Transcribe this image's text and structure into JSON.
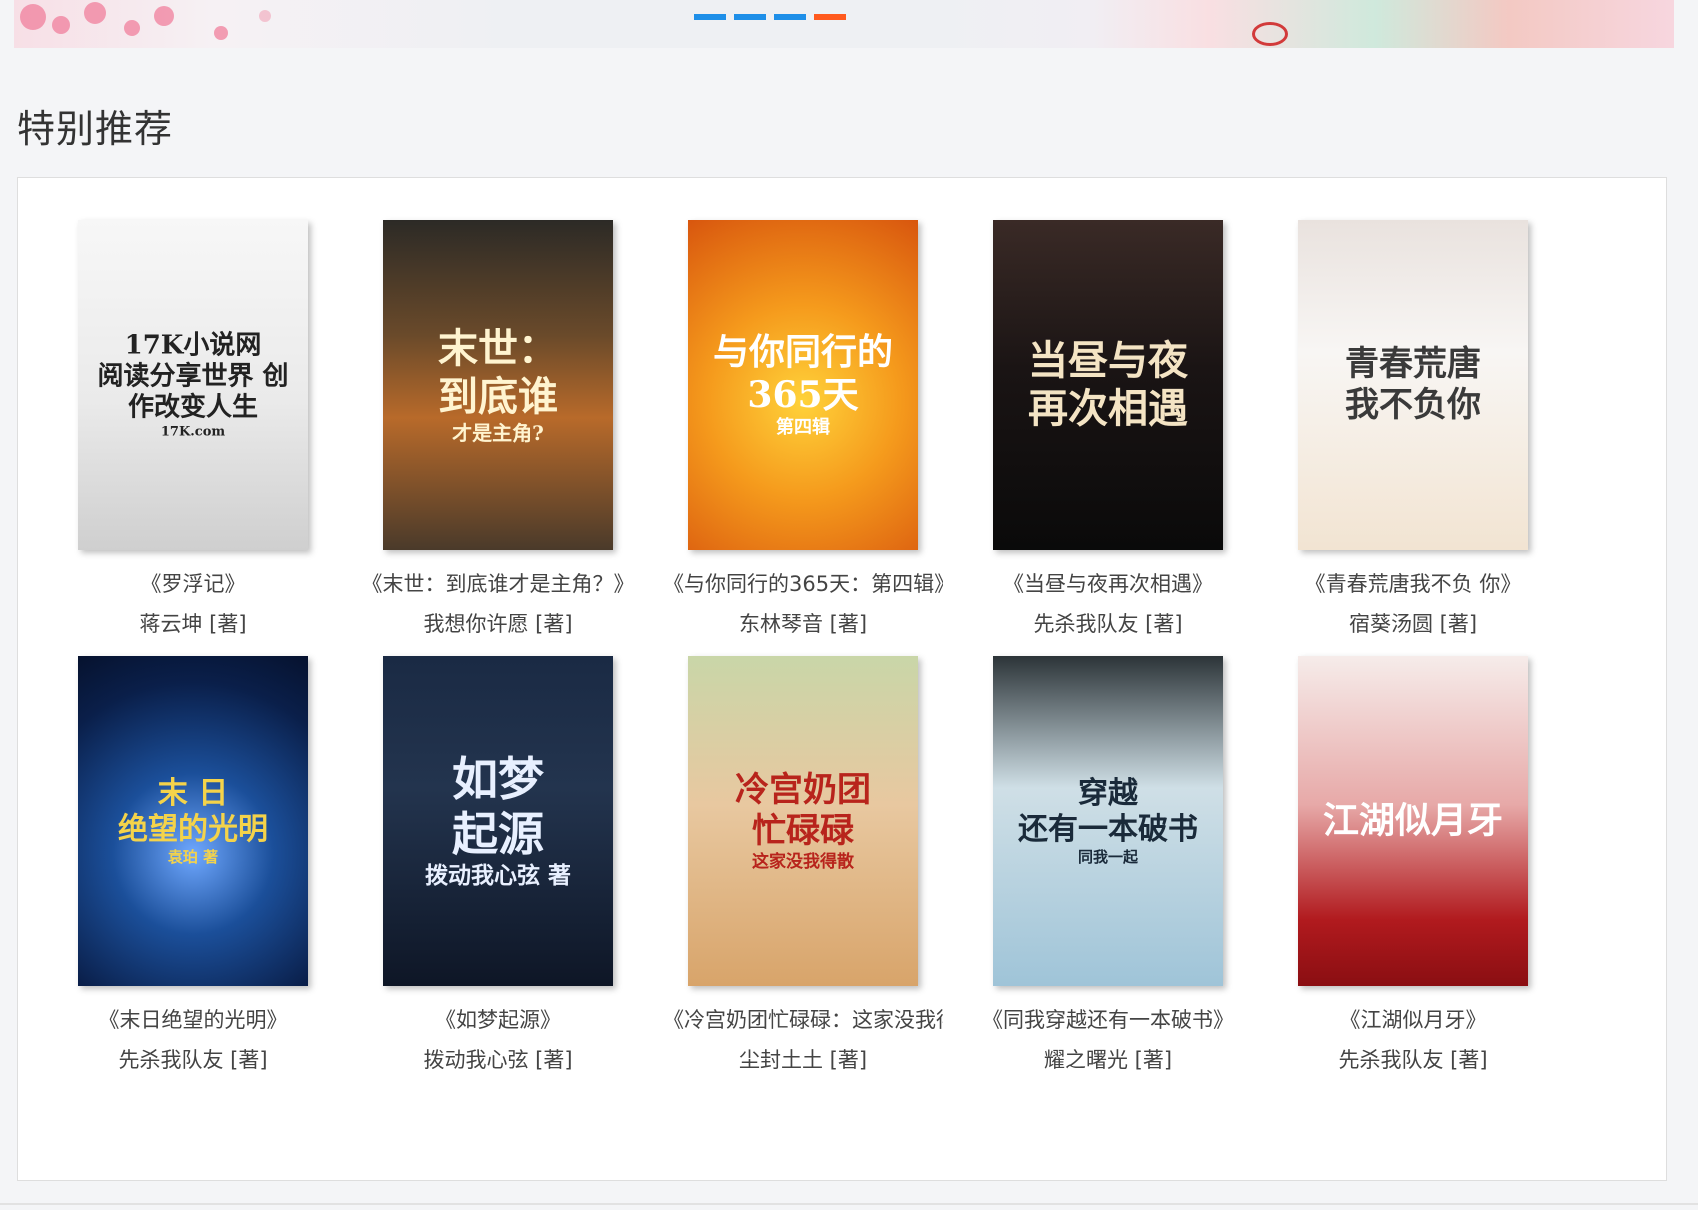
{
  "section": {
    "title": "特别推荐"
  },
  "carousel": {
    "active_index": 3,
    "count": 4
  },
  "books": [
    {
      "title": "《罗浮记》",
      "author": "蒋云坤 [著]",
      "cover_lines": [
        "17K小说网",
        "阅读分享世界 创作改变人生",
        "17K.com"
      ],
      "cover_style": "light"
    },
    {
      "title": "《末世：到底谁才是主角？》",
      "author": "我想你许愿 [著]",
      "cover_lines": [
        "末世：",
        "到底谁",
        "才是主角?"
      ],
      "cover_style": "war"
    },
    {
      "title": "《与你同行的365天：第四辑》",
      "author": "东林琴音 [著]",
      "cover_lines": [
        "与你同行的",
        "365天",
        "第四辑"
      ],
      "cover_style": "orange"
    },
    {
      "title": "《当昼与夜再次相遇》",
      "author": "先杀我队友 [著]",
      "cover_lines": [
        "当昼与夜",
        "再次相遇"
      ],
      "cover_style": "dark"
    },
    {
      "title": "《青春荒唐我不负 你》",
      "author": "宿葵汤圆 [著]",
      "cover_lines": [
        "青春荒唐",
        "我不负你"
      ],
      "cover_style": "pale"
    },
    {
      "title": "《末日绝望的光明》",
      "author": "先杀我队友 [著]",
      "cover_lines": [
        "末 日",
        "绝望的光明",
        "袁珀 著"
      ],
      "cover_style": "space"
    },
    {
      "title": "《如梦起源》",
      "author": "拨动我心弦 [著]",
      "cover_lines": [
        "如梦",
        "起源",
        "拨动我心弦 著"
      ],
      "cover_style": "fantasy"
    },
    {
      "title": "《冷宫奶团忙碌碌：这家没我得散》",
      "author": "尘封土土 [著]",
      "cover_lines": [
        "冷宫奶团",
        "忙碌碌",
        "这家没我得散"
      ],
      "cover_style": "palace"
    },
    {
      "title": "《同我穿越还有一本破书》",
      "author": "耀之曙光 [著]",
      "cover_lines": [
        "穿越",
        "还有一本破书",
        "同我一起"
      ],
      "cover_style": "ghost"
    },
    {
      "title": "《江湖似月牙》",
      "author": "先杀我队友 [著]",
      "cover_lines": [
        "江湖似月牙"
      ],
      "cover_style": "red"
    }
  ]
}
